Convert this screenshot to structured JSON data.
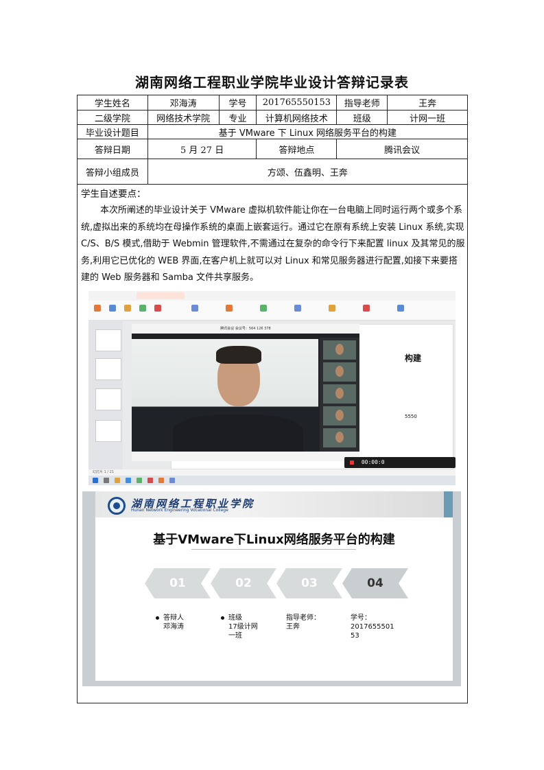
{
  "doc": {
    "title": "湖南网络工程职业学院毕业设计答辩记录表"
  },
  "table": {
    "student_name_label": "学生姓名",
    "student_name": "邓海涛",
    "student_id_label": "学号",
    "student_id": "201765550153",
    "advisor_label": "指导老师",
    "advisor": "王奔",
    "college_label": "二级学院",
    "college": "网络技术学院",
    "major_label": "专业",
    "major": "计算机网络技术",
    "class_label": "班级",
    "class": "计网一班",
    "topic_label": "毕业设计题目",
    "topic": "基于 VMware 下 Linux 网络服务平台的构建",
    "date_label": "答辩日期",
    "date": "5 月 27 日",
    "place_label": "答辩地点",
    "place": "腾讯会议",
    "members_label": "答辩小组成员",
    "members": "方颂、伍鑫明、王奔"
  },
  "statement": {
    "heading": "学生自述要点：",
    "body": "本次所阐述的毕业设计关于 VMware 虚拟机软件能让你在一台电脑上同时运行两个或多个系统,虚拟出来的系统均在母操作系统的桌面上嵌套运行。通过它在原有系统上安装 Linux 系统,实现 C/S、B/S 模式,借助于 Webmin 管理软件,不需通过在复杂的命令行下来配置 linux 及其常见的服务,利用它已优化的 WEB 界面,在客户机上就可以对 Linux 和常见服务器进行配置,如接下来要搭建的 Web 服务器和 Samba 文件共享服务。"
  },
  "screenshot1": {
    "meeting_id": "腾讯会议 会议号：564 126 378",
    "slide_heading": "构建",
    "slide_number": "5550",
    "recording_time": "00:00:0",
    "status_text": "幻灯片 1 / 21"
  },
  "slide": {
    "college_cn": "湖南网络工程职业学院",
    "college_en": "Hunan Network Engineering Vocational College",
    "title": "基于VMware下Linux网络服务平台的构建",
    "steps": [
      "01",
      "02",
      "03",
      "04"
    ],
    "defender_label": "答辩人",
    "defender": "邓海涛",
    "class_label": "班级",
    "class_value": "17级计网一班",
    "advisor_label": "指导老师：",
    "advisor": "王奔",
    "id_label": "学号：",
    "id_value": "201765550153"
  },
  "colors": {
    "chevron_light": "#d7dbdc",
    "chevron_active": "#c9cfd1",
    "chevron_text": "#ffffff",
    "chevron_active_text": "#333333",
    "accent_blue": "#1c4c8f"
  }
}
